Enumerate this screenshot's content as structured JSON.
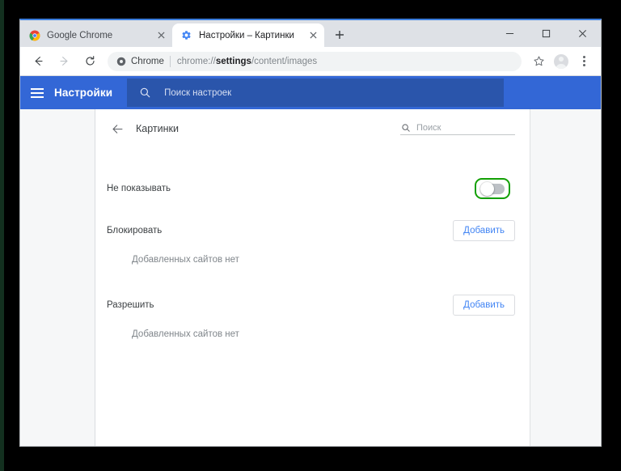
{
  "window": {
    "controls": {
      "minimize": "—",
      "maximize": "▢",
      "close": "✕"
    }
  },
  "tabs": [
    {
      "title": "Google Chrome",
      "favicon": "chrome-logo-icon",
      "active": false,
      "close_label": "✕"
    },
    {
      "title": "Настройки – Картинки",
      "favicon": "settings-gear-icon",
      "active": true,
      "close_label": "✕"
    }
  ],
  "newtab": {
    "label": "+"
  },
  "toolbar": {
    "back_label": "←",
    "forward_label": "→",
    "reload_label": "⟳",
    "omnibox": {
      "security_icon": "chrome-page-icon",
      "scheme_label": "Chrome",
      "url_prefix": "chrome://",
      "url_bold": "settings",
      "url_suffix": "/content/images"
    },
    "bookmark_label": "☆",
    "profile_label": "profile-avatar",
    "menu_label": "⋮"
  },
  "settings_header": {
    "menu_label": "menu",
    "title": "Настройки",
    "search_placeholder": "Поиск настроек",
    "search_icon": "search-icon"
  },
  "content": {
    "back_label": "←",
    "title": "Картинки",
    "search_placeholder": "Поиск",
    "search_icon": "search-icon",
    "toggle_row": {
      "label": "Не показывать",
      "state": "off",
      "highlight_color": "#13a005"
    },
    "sections": [
      {
        "title": "Блокировать",
        "add_label": "Добавить",
        "empty_text": "Добавленных сайтов нет"
      },
      {
        "title": "Разрешить",
        "add_label": "Добавить",
        "empty_text": "Добавленных сайтов нет"
      }
    ]
  },
  "colors": {
    "settings_blue": "#3367d6",
    "link_blue": "#4285f4",
    "highlight_green": "#13a005",
    "tabstrip_gray": "#dee1e6"
  }
}
